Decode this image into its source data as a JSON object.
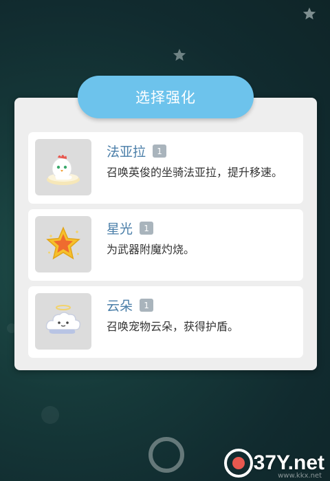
{
  "dialog": {
    "title": "选择强化"
  },
  "options": [
    {
      "name": "法亚拉",
      "level": "1",
      "description": "召唤英俊的坐骑法亚拉，提升移速。",
      "icon": "chicken-mount-icon"
    },
    {
      "name": "星光",
      "level": "1",
      "description": "为武器附魔灼烧。",
      "icon": "star-icon"
    },
    {
      "name": "云朵",
      "level": "1",
      "description": "召唤宠物云朵，获得护盾。",
      "icon": "cloud-pet-icon"
    }
  ],
  "watermark": {
    "logo": "37Y.net",
    "url": "www.kkx.net"
  },
  "colors": {
    "title_pill": "#6dc3ec",
    "option_name": "#4a7ea8",
    "level_badge": "#a9b4bc",
    "panel": "#eeeeee"
  }
}
